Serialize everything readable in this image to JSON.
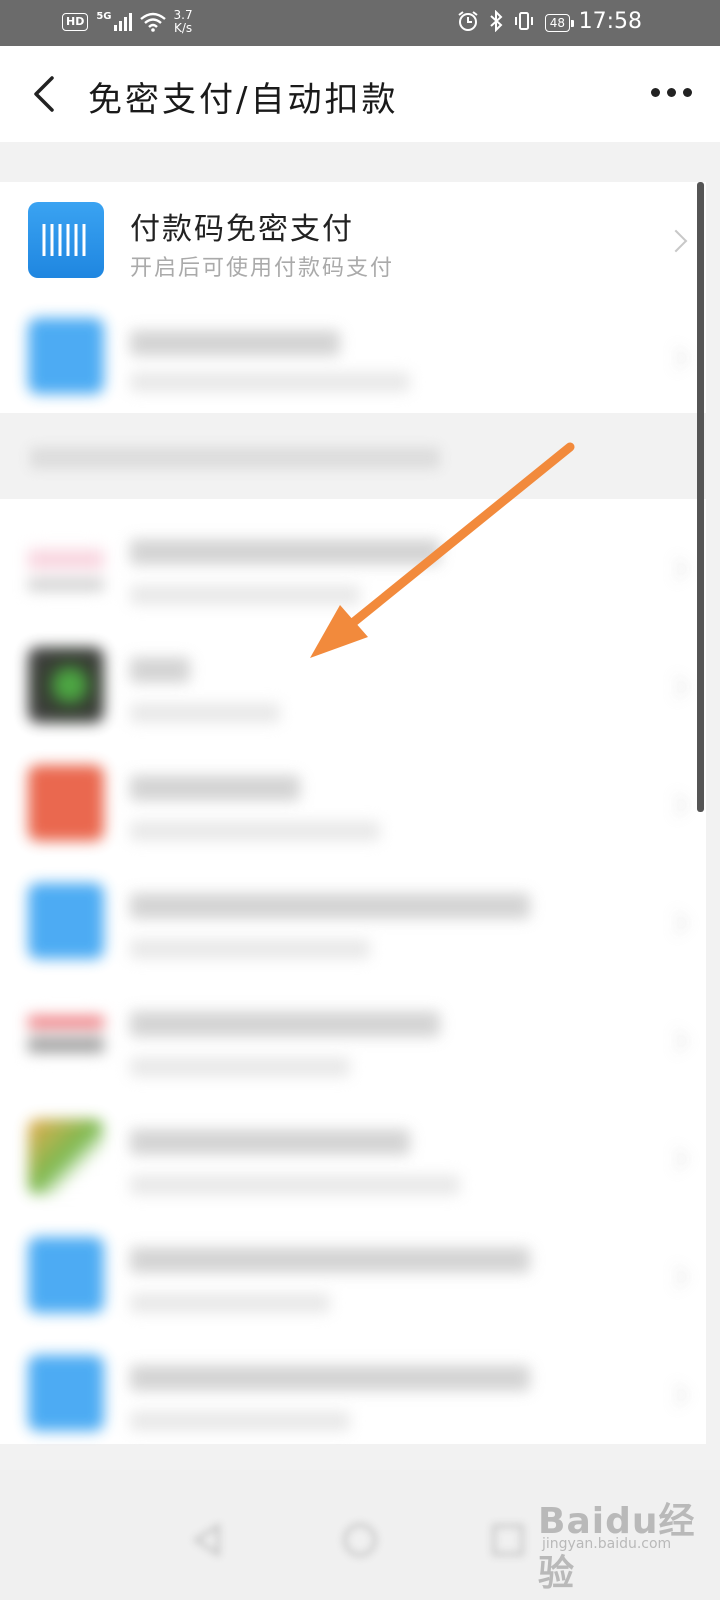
{
  "status_bar": {
    "hd": "HD",
    "signal": "5G",
    "speed_value": "3.7",
    "speed_unit": "K/s",
    "battery": "48",
    "time": "17:58"
  },
  "header": {
    "title": "免密支付/自动扣款"
  },
  "list": {
    "first_item": {
      "title": "付款码免密支付",
      "subtitle": "开启后可使用付款码支付"
    }
  },
  "colors": {
    "accent_blue": "#3aa3f2",
    "arrow_orange": "#f28a3c"
  },
  "watermark": {
    "brand": "Baidu经验",
    "url": "jingyan.baidu.com"
  }
}
